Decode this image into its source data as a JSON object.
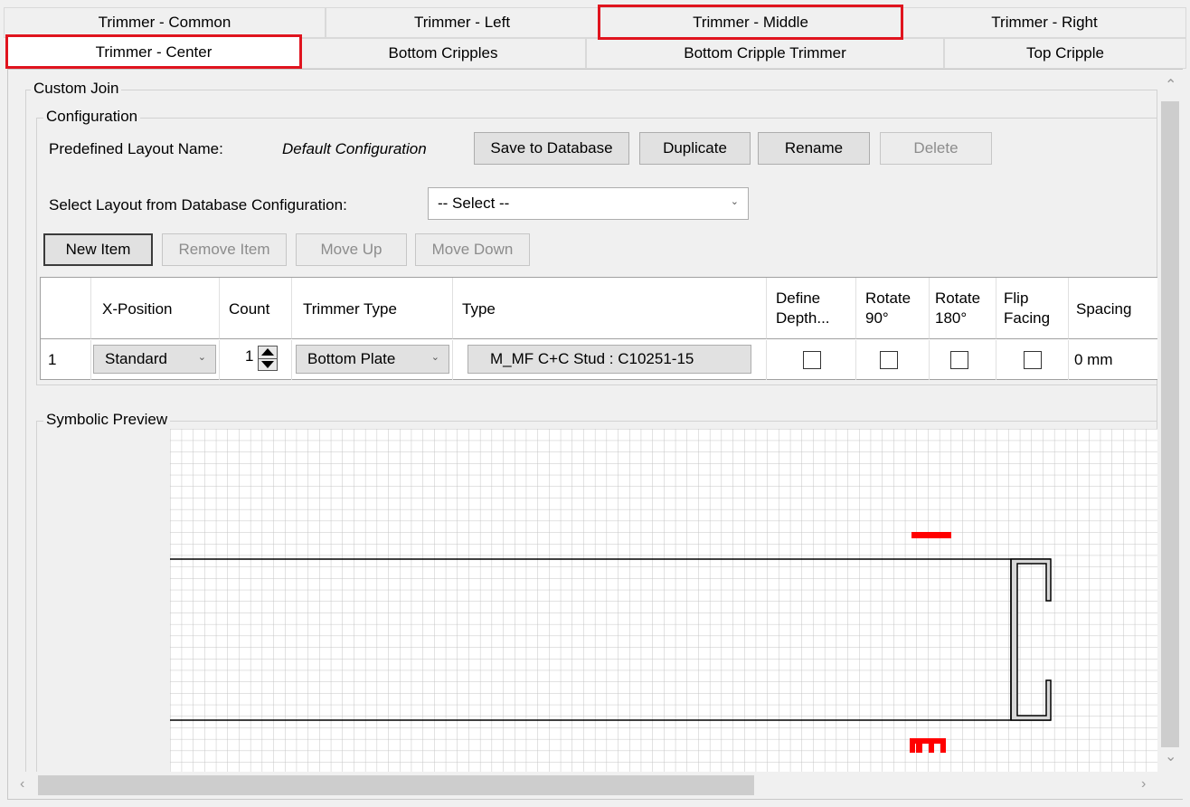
{
  "tabs": {
    "row1": [
      "Trimmer - Common",
      "Trimmer - Left",
      "Trimmer - Middle",
      "Trimmer - Right"
    ],
    "row2": [
      "Trimmer - Center",
      "Bottom Cripples",
      "Bottom Cripple Trimmer",
      "Top Cripple"
    ]
  },
  "custom_join": {
    "title": "Custom Join",
    "configuration": {
      "title": "Configuration",
      "predefined_label": "Predefined Layout Name:",
      "predefined_value": "Default Configuration",
      "save_button": "Save to Database",
      "duplicate_button": "Duplicate",
      "rename_button": "Rename",
      "delete_button": "Delete",
      "select_label": "Select Layout from Database Configuration:",
      "select_value": "-- Select --",
      "new_item_button": "New Item",
      "remove_item_button": "Remove Item",
      "move_up_button": "Move Up",
      "move_down_button": "Move Down"
    },
    "table": {
      "headers": {
        "x_position": "X-Position",
        "count": "Count",
        "trimmer_type": "Trimmer Type",
        "type": "Type",
        "define_depth_1": "Define",
        "define_depth_2": "Depth...",
        "rotate90_1": "Rotate",
        "rotate90_2": "90°",
        "rotate180_1": "Rotate",
        "rotate180_2": "180°",
        "flip_1": "Flip",
        "flip_2": "Facing",
        "spacing": "Spacing"
      },
      "rows": [
        {
          "index": "1",
          "x_position": "Standard",
          "count": "1",
          "trimmer_type": "Bottom Plate",
          "type": "M_MF C+C Stud : C10251-15",
          "spacing": "0 mm"
        }
      ]
    },
    "preview": {
      "title": "Symbolic Preview"
    }
  },
  "colors": {
    "highlight": "#e0141e",
    "marker": "#ff0000"
  },
  "icons": [
    "chevron-down-icon",
    "spin-up-icon",
    "spin-down-icon",
    "scroll-up-icon",
    "scroll-down-icon",
    "scroll-left-icon",
    "scroll-right-icon"
  ]
}
